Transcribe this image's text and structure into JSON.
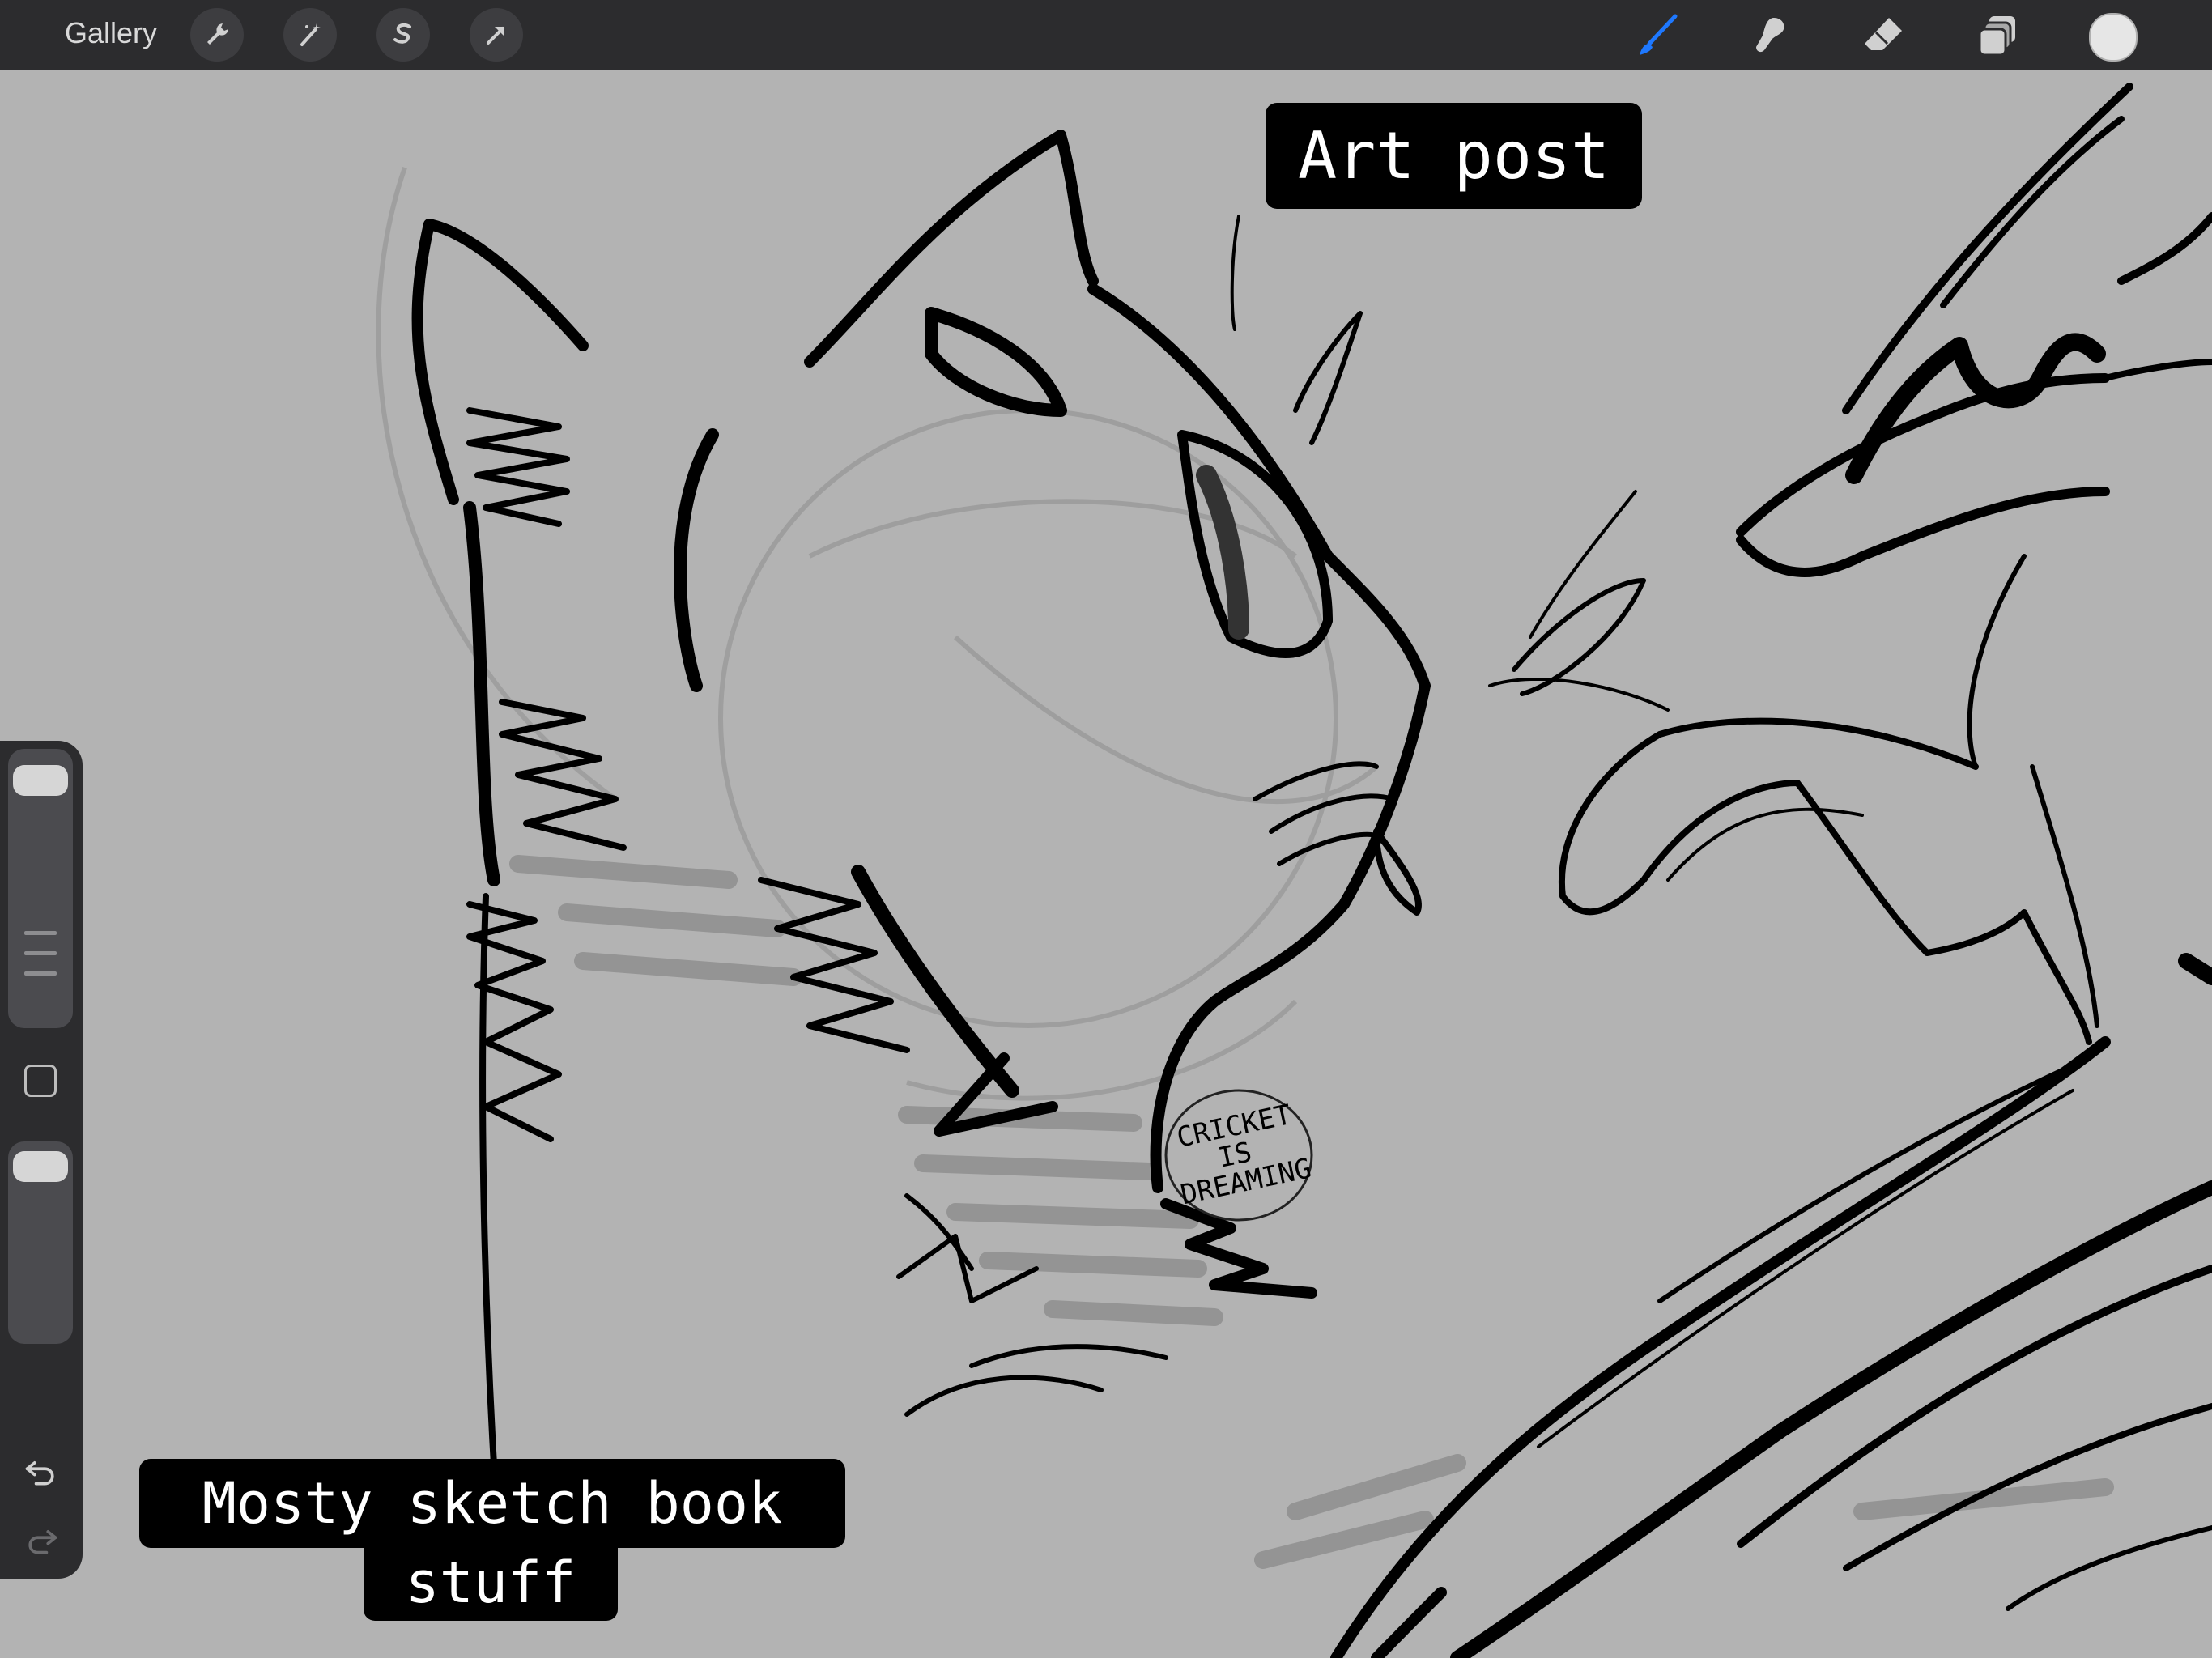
{
  "toolbar": {
    "gallery_label": "Gallery",
    "left_icons": [
      "wrench-icon",
      "magic-wand-icon",
      "selection-s-icon",
      "transform-arrow-icon"
    ],
    "right_icons": [
      "brush-icon",
      "smudge-icon",
      "eraser-icon",
      "layers-icon"
    ],
    "active_tool": "brush-icon",
    "active_color": "#1e78ff",
    "current_color": "#e6e6e6"
  },
  "sidebar": {
    "icons": [
      "modify-square-icon",
      "undo-icon",
      "redo-icon"
    ]
  },
  "overlay": {
    "title": "Art post",
    "caption_line1": "Mosty sketch book",
    "caption_line2": "stuff"
  },
  "signature": {
    "lines": [
      "CRICKET",
      "IS",
      "DREAMING"
    ]
  }
}
